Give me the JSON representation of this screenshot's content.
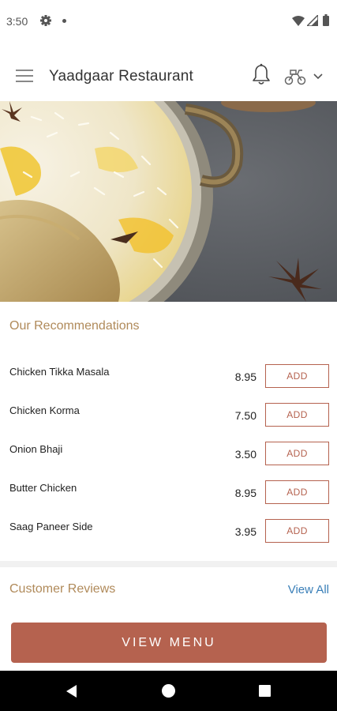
{
  "status_bar": {
    "time": "3:50",
    "icons": [
      "gear-icon",
      "dot-icon",
      "wifi-icon",
      "signal-icon",
      "battery-icon"
    ]
  },
  "header": {
    "title": "Yaadgaar Restaurant",
    "icons": [
      "menu-icon",
      "bell-icon",
      "scooter-icon",
      "chevron-down-icon"
    ]
  },
  "recommendations": {
    "title": "Our Recommendations",
    "add_label": "ADD",
    "items": [
      {
        "name": "Chicken Tikka Masala",
        "price": "8.95"
      },
      {
        "name": "Chicken Korma",
        "price": "7.50"
      },
      {
        "name": "Onion Bhaji",
        "price": "3.50"
      },
      {
        "name": "Butter Chicken",
        "price": "8.95"
      },
      {
        "name": "Saag Paneer Side",
        "price": "3.95"
      }
    ]
  },
  "reviews": {
    "title": "Customer Reviews",
    "view_all": "View All"
  },
  "cta": {
    "label": "VIEW MENU"
  },
  "colors": {
    "accent": "#b5624f",
    "section_title": "#b08a5a",
    "link": "#3a7fb8"
  }
}
